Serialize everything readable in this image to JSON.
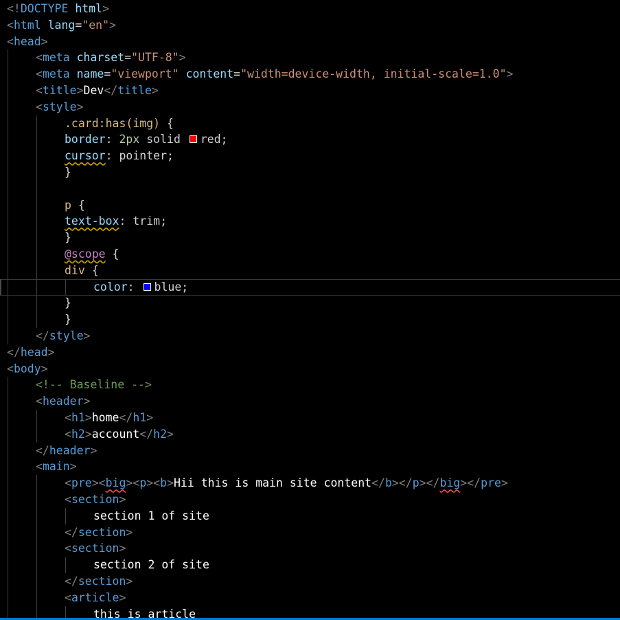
{
  "editor": {
    "language": "html",
    "colors": {
      "background": "#000000",
      "tag": "#569cd6",
      "bracket": "#808080",
      "attribute": "#9cdcfe",
      "string": "#ce9178",
      "comment": "#6a9955",
      "selector": "#d7ba7d",
      "at_rule": "#c586c0",
      "number": "#b5cea8",
      "text": "#ffffff",
      "swatch_red": "#ff0000",
      "swatch_blue": "#0000ff",
      "status_bar": "#007acc"
    },
    "lines": [
      {
        "s": [
          {
            "c": "t-brk",
            "t": "<!"
          },
          {
            "c": "t-tag",
            "t": "DOCTYPE"
          },
          {
            "c": "t-plain",
            "t": " "
          },
          {
            "c": "t-attr",
            "t": "html"
          },
          {
            "c": "t-brk",
            "t": ">"
          }
        ]
      },
      {
        "s": [
          {
            "c": "t-brk",
            "t": "<"
          },
          {
            "c": "t-tag",
            "t": "html"
          },
          {
            "c": "t-plain",
            "t": " "
          },
          {
            "c": "t-attr",
            "t": "lang"
          },
          {
            "c": "t-plain",
            "t": "="
          },
          {
            "c": "t-str",
            "t": "\"en\""
          },
          {
            "c": "t-brk",
            "t": ">"
          }
        ]
      },
      {
        "s": [
          {
            "c": "t-brk",
            "t": "<"
          },
          {
            "c": "t-tag",
            "t": "head"
          },
          {
            "c": "t-brk",
            "t": ">"
          }
        ]
      },
      {
        "s": [
          {
            "c": "t-brk",
            "t": "<"
          },
          {
            "c": "t-tag",
            "t": "meta"
          },
          {
            "c": "t-plain",
            "t": " "
          },
          {
            "c": "t-attr",
            "t": "charset"
          },
          {
            "c": "t-plain",
            "t": "="
          },
          {
            "c": "t-str",
            "t": "\"UTF-8\""
          },
          {
            "c": "t-brk",
            "t": ">"
          }
        ]
      },
      {
        "s": [
          {
            "c": "t-brk",
            "t": "<"
          },
          {
            "c": "t-tag",
            "t": "meta"
          },
          {
            "c": "t-plain",
            "t": " "
          },
          {
            "c": "t-attr",
            "t": "name"
          },
          {
            "c": "t-plain",
            "t": "="
          },
          {
            "c": "t-str",
            "t": "\"viewport\""
          },
          {
            "c": "t-plain",
            "t": " "
          },
          {
            "c": "t-attr",
            "t": "content"
          },
          {
            "c": "t-plain",
            "t": "="
          },
          {
            "c": "t-str",
            "t": "\"width=device-width, initial-scale=1.0\""
          },
          {
            "c": "t-brk",
            "t": ">"
          }
        ]
      },
      {
        "s": [
          {
            "c": "t-brk",
            "t": "<"
          },
          {
            "c": "t-tag",
            "t": "title"
          },
          {
            "c": "t-brk",
            "t": ">"
          },
          {
            "c": "t-txt",
            "t": "Dev"
          },
          {
            "c": "t-brk",
            "t": "</"
          },
          {
            "c": "t-tag",
            "t": "title"
          },
          {
            "c": "t-brk",
            "t": ">"
          }
        ]
      },
      {
        "s": [
          {
            "c": "t-brk",
            "t": "<"
          },
          {
            "c": "t-tag",
            "t": "style"
          },
          {
            "c": "t-brk",
            "t": ">"
          }
        ]
      },
      {
        "s": [
          {
            "c": "t-sel",
            "t": ".card:has(img)"
          },
          {
            "c": "t-plain",
            "t": " {"
          }
        ]
      },
      {
        "s": [
          {
            "c": "t-prop",
            "t": "border"
          },
          {
            "c": "t-plain",
            "t": ": "
          },
          {
            "c": "t-num",
            "t": "2px"
          },
          {
            "c": "t-plain",
            "t": " solid "
          },
          {
            "c": "swatch",
            "color": "#ff0000"
          },
          {
            "c": "t-plain",
            "t": "red;"
          }
        ]
      },
      {
        "s": [
          {
            "c": "t-prop squig-warn",
            "t": "cursor"
          },
          {
            "c": "t-plain",
            "t": ": pointer;"
          }
        ]
      },
      {
        "s": [
          {
            "c": "t-plain",
            "t": "}"
          }
        ]
      },
      {
        "s": []
      },
      {
        "s": [
          {
            "c": "t-sel",
            "t": "p"
          },
          {
            "c": "t-plain",
            "t": " {"
          }
        ]
      },
      {
        "s": [
          {
            "c": "t-prop squig-warn",
            "t": "text-box"
          },
          {
            "c": "t-plain",
            "t": ": trim;"
          }
        ]
      },
      {
        "s": [
          {
            "c": "t-plain",
            "t": "}"
          }
        ]
      },
      {
        "s": [
          {
            "c": "t-at squig-warn",
            "t": "@scope"
          },
          {
            "c": "t-plain",
            "t": " {"
          }
        ]
      },
      {
        "s": [
          {
            "c": "t-sel",
            "t": "div"
          },
          {
            "c": "t-plain",
            "t": " {"
          }
        ]
      },
      {
        "s": [
          {
            "c": "t-prop",
            "t": "color"
          },
          {
            "c": "t-plain",
            "t": ": "
          },
          {
            "c": "swatch",
            "color": "#0000ff"
          },
          {
            "c": "t-plain",
            "t": "blue;"
          }
        ]
      },
      {
        "s": [
          {
            "c": "t-plain",
            "t": "}"
          }
        ]
      },
      {
        "s": [
          {
            "c": "t-plain",
            "t": "}"
          }
        ]
      },
      {
        "s": [
          {
            "c": "t-brk",
            "t": "</"
          },
          {
            "c": "t-tag",
            "t": "style"
          },
          {
            "c": "t-brk",
            "t": ">"
          }
        ]
      },
      {
        "s": [
          {
            "c": "t-brk",
            "t": "</"
          },
          {
            "c": "t-tag",
            "t": "head"
          },
          {
            "c": "t-brk",
            "t": ">"
          }
        ]
      },
      {
        "s": [
          {
            "c": "t-brk",
            "t": "<"
          },
          {
            "c": "t-tag",
            "t": "body"
          },
          {
            "c": "t-brk",
            "t": ">"
          }
        ]
      },
      {
        "s": [
          {
            "c": "t-com",
            "t": "<!-- Baseline -->"
          }
        ]
      },
      {
        "s": [
          {
            "c": "t-brk",
            "t": "<"
          },
          {
            "c": "t-tag",
            "t": "header"
          },
          {
            "c": "t-brk",
            "t": ">"
          }
        ]
      },
      {
        "s": [
          {
            "c": "t-brk",
            "t": "<"
          },
          {
            "c": "t-tag",
            "t": "h1"
          },
          {
            "c": "t-brk",
            "t": ">"
          },
          {
            "c": "t-txt",
            "t": "home"
          },
          {
            "c": "t-brk",
            "t": "</"
          },
          {
            "c": "t-tag",
            "t": "h1"
          },
          {
            "c": "t-brk",
            "t": ">"
          }
        ]
      },
      {
        "s": [
          {
            "c": "t-brk",
            "t": "<"
          },
          {
            "c": "t-tag",
            "t": "h2"
          },
          {
            "c": "t-brk",
            "t": ">"
          },
          {
            "c": "t-txt",
            "t": "account"
          },
          {
            "c": "t-brk",
            "t": "</"
          },
          {
            "c": "t-tag",
            "t": "h2"
          },
          {
            "c": "t-brk",
            "t": ">"
          }
        ]
      },
      {
        "s": [
          {
            "c": "t-brk",
            "t": "</"
          },
          {
            "c": "t-tag",
            "t": "header"
          },
          {
            "c": "t-brk",
            "t": ">"
          }
        ]
      },
      {
        "s": [
          {
            "c": "t-brk",
            "t": "<"
          },
          {
            "c": "t-tag",
            "t": "main"
          },
          {
            "c": "t-brk",
            "t": ">"
          }
        ]
      },
      {
        "s": [
          {
            "c": "t-brk",
            "t": "<"
          },
          {
            "c": "t-tag",
            "t": "pre"
          },
          {
            "c": "t-brk",
            "t": "><"
          },
          {
            "c": "t-tag squig-err",
            "t": "big"
          },
          {
            "c": "t-brk",
            "t": "><"
          },
          {
            "c": "t-tag",
            "t": "p"
          },
          {
            "c": "t-brk",
            "t": "><"
          },
          {
            "c": "t-tag",
            "t": "b"
          },
          {
            "c": "t-brk",
            "t": ">"
          },
          {
            "c": "t-txt",
            "t": "Hii this is main site content"
          },
          {
            "c": "t-brk",
            "t": "</"
          },
          {
            "c": "t-tag",
            "t": "b"
          },
          {
            "c": "t-brk",
            "t": "></"
          },
          {
            "c": "t-tag",
            "t": "p"
          },
          {
            "c": "t-brk",
            "t": "></"
          },
          {
            "c": "t-tag squig-err",
            "t": "big"
          },
          {
            "c": "t-brk",
            "t": "></"
          },
          {
            "c": "t-tag",
            "t": "pre"
          },
          {
            "c": "t-brk",
            "t": ">"
          }
        ]
      },
      {
        "s": [
          {
            "c": "t-brk",
            "t": "<"
          },
          {
            "c": "t-tag",
            "t": "section"
          },
          {
            "c": "t-brk",
            "t": ">"
          }
        ]
      },
      {
        "s": [
          {
            "c": "t-txt",
            "t": "section 1 of site"
          }
        ]
      },
      {
        "s": [
          {
            "c": "t-brk",
            "t": "</"
          },
          {
            "c": "t-tag",
            "t": "section"
          },
          {
            "c": "t-brk",
            "t": ">"
          }
        ]
      },
      {
        "s": [
          {
            "c": "t-brk",
            "t": "<"
          },
          {
            "c": "t-tag",
            "t": "section"
          },
          {
            "c": "t-brk",
            "t": ">"
          }
        ]
      },
      {
        "s": [
          {
            "c": "t-txt",
            "t": "section 2 of site"
          }
        ]
      },
      {
        "s": [
          {
            "c": "t-brk",
            "t": "</"
          },
          {
            "c": "t-tag",
            "t": "section"
          },
          {
            "c": "t-brk",
            "t": ">"
          }
        ]
      },
      {
        "s": [
          {
            "c": "t-brk",
            "t": "<"
          },
          {
            "c": "t-tag",
            "t": "article"
          },
          {
            "c": "t-brk",
            "t": ">"
          }
        ]
      },
      {
        "s": [
          {
            "c": "t-txt",
            "t": "this is article"
          }
        ]
      }
    ]
  }
}
